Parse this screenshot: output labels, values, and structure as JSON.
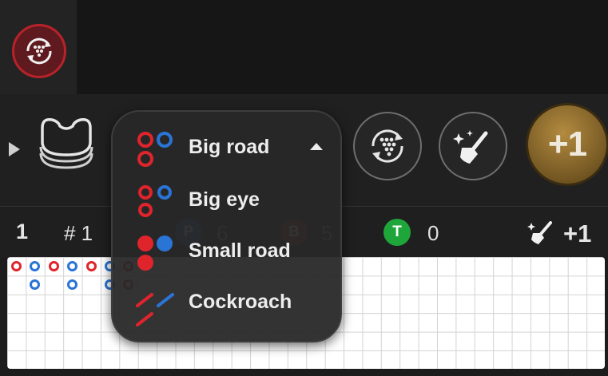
{
  "colors": {
    "banker_red": "#e0242c",
    "player_blue": "#2a74d6",
    "tie_green": "#1fa63a",
    "gold": "#b38b40"
  },
  "header": {
    "history_icon": "road-history-icon"
  },
  "toolbar": {
    "shoe_icon": "card-shoe-icon",
    "shuffle_icon": "shuffle-road-icon",
    "clean_icon": "sweep-clean-icon",
    "plus_one_label": "+1"
  },
  "stats": {
    "round": "1",
    "shoe_number": "# 1",
    "player_letter": "P",
    "player_count": "6",
    "banker_letter": "B",
    "banker_count": "5",
    "tie_letter": "T",
    "tie_count": "0",
    "clean_plus_label": "+1"
  },
  "road_menu": {
    "items": [
      {
        "label": "Big road",
        "icon": "big-road-icon",
        "selected": true
      },
      {
        "label": "Big eye",
        "icon": "big-eye-icon"
      },
      {
        "label": "Small road",
        "icon": "small-road-icon"
      },
      {
        "label": "Cockroach",
        "icon": "cockroach-icon"
      }
    ]
  },
  "roadmap": {
    "beads": [
      {
        "col": 0,
        "row": 0,
        "result": "banker"
      },
      {
        "col": 1,
        "row": 0,
        "result": "player"
      },
      {
        "col": 1,
        "row": 1,
        "result": "player"
      },
      {
        "col": 2,
        "row": 0,
        "result": "banker"
      },
      {
        "col": 3,
        "row": 0,
        "result": "player"
      },
      {
        "col": 3,
        "row": 1,
        "result": "player"
      },
      {
        "col": 4,
        "row": 0,
        "result": "banker"
      },
      {
        "col": 5,
        "row": 0,
        "result": "player"
      },
      {
        "col": 5,
        "row": 1,
        "result": "player"
      },
      {
        "col": 6,
        "row": 0,
        "result": "banker"
      },
      {
        "col": 6,
        "row": 1,
        "result": "banker"
      }
    ]
  }
}
